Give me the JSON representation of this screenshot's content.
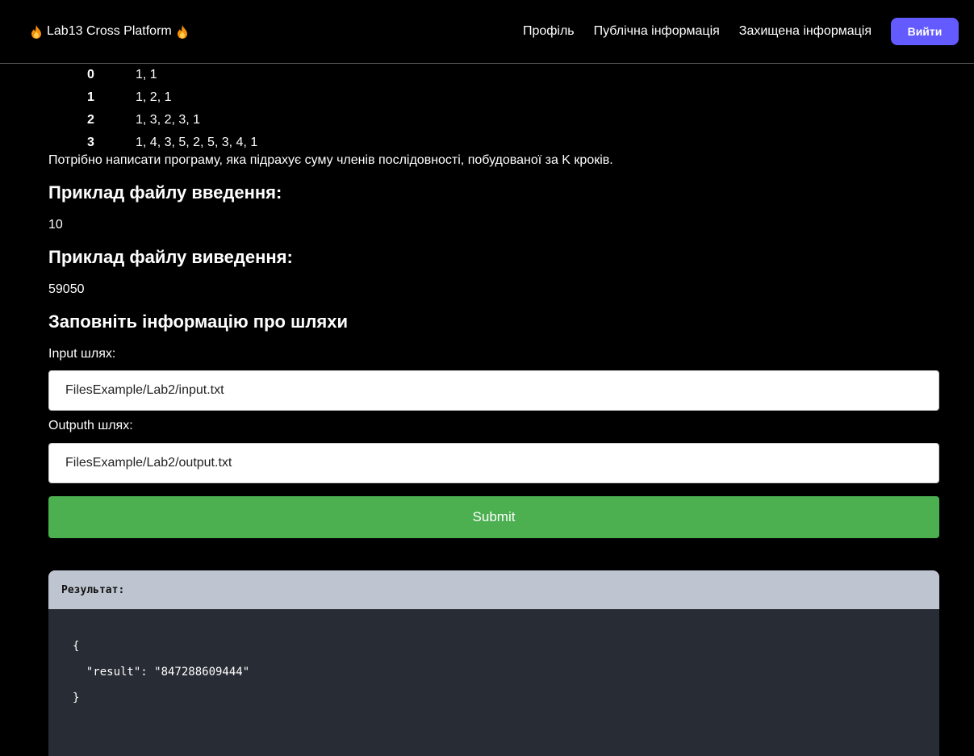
{
  "navbar": {
    "brand": "Lab13 Cross Platform",
    "links": [
      "Профіль",
      "Публічна інформація",
      "Захищена інформація"
    ],
    "logout": "Вийти"
  },
  "sequence_table": [
    {
      "k": "0",
      "seq": "1, 1"
    },
    {
      "k": "1",
      "seq": "1, 2, 1"
    },
    {
      "k": "2",
      "seq": "1, 3, 2, 3, 1"
    },
    {
      "k": "3",
      "seq": "1, 4, 3, 5, 2, 5, 3, 4, 1"
    }
  ],
  "task_text": "Потрібно написати програму, яка підрахує суму членів послідовності, побудованої за K кроків.",
  "input_example": {
    "heading": "Приклад файлу введення:",
    "value": "10"
  },
  "output_example": {
    "heading": "Приклад файлу виведення:",
    "value": "59050"
  },
  "form": {
    "heading": "Заповніть інформацію про шляхи",
    "input_label": "Input шлях:",
    "input_value": "FilesExample/Lab2/input.txt",
    "output_label": "Outputh шлях:",
    "output_value": "FilesExample/Lab2/output.txt",
    "submit": "Submit"
  },
  "result": {
    "title": "Результат:",
    "lines": [
      "{",
      "  \"result\": \"847288609444\"",
      "}"
    ]
  },
  "colors": {
    "background": "#000000",
    "accent_button": "#635bff",
    "submit_button": "#4caf50",
    "result_header": "#bec4d0",
    "result_body": "#282c34"
  },
  "icons": [
    "fire-icon"
  ]
}
